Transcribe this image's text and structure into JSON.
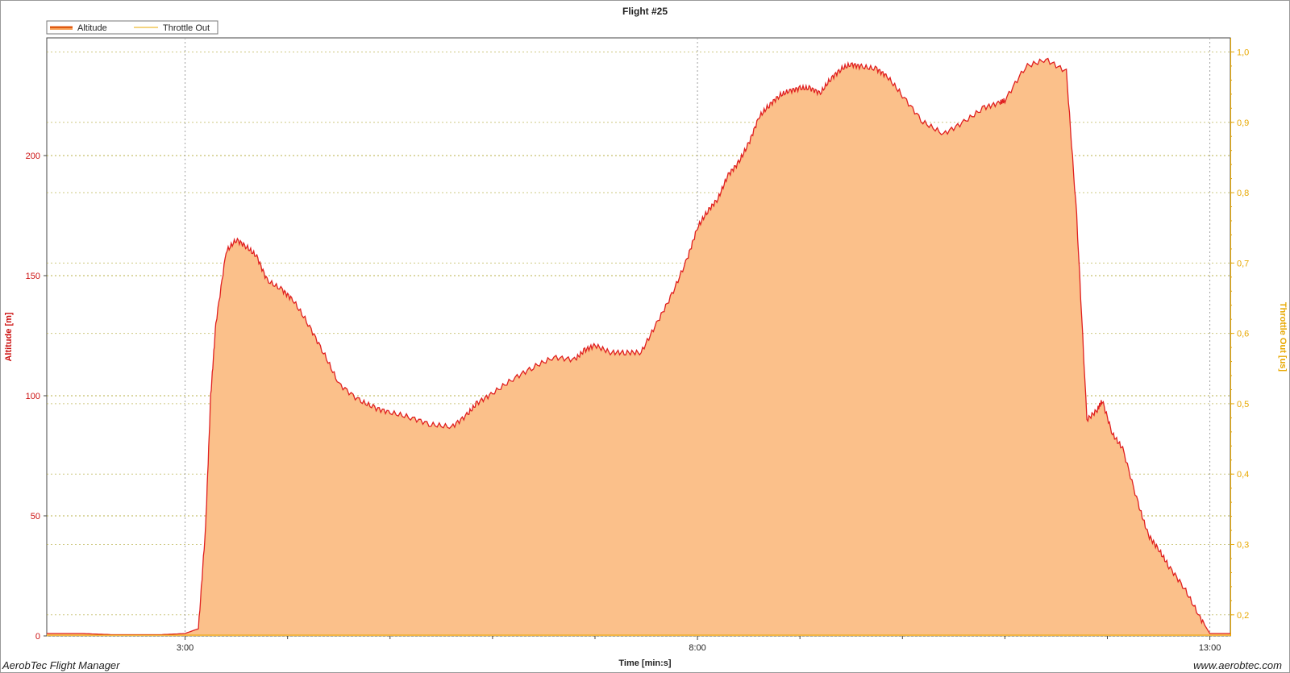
{
  "footer": {
    "app_name": "AerobTec Flight Manager",
    "site_url": "www.aerobtec.com"
  },
  "colors": {
    "altitude": "#e02020",
    "altitude_fill": "#fbc08a",
    "throttle": "#e8a800",
    "grid_y": "#b9b04a",
    "grid_x": "#a0a0a0"
  },
  "chart_data": {
    "type": "area",
    "title": "Flight #25",
    "xlabel": "Time [min:s]",
    "ylabel": "Altitude [m]",
    "y2label": "Throttle Out [us]",
    "legend_position": "top-left",
    "grid": true,
    "xlim_min": [
      1.65,
      13.2
    ],
    "ylim": [
      0,
      249
    ],
    "y2lim": [
      0.17,
      1.02
    ],
    "x_ticks": [
      {
        "label": "3:00",
        "value": 3
      },
      {
        "label": "8:00",
        "value": 8
      },
      {
        "label": "13:00",
        "value": 13
      }
    ],
    "x_minor_ticks": [
      4,
      5,
      6,
      7,
      9,
      10,
      11,
      12
    ],
    "y_ticks": [
      0,
      50,
      100,
      150,
      200
    ],
    "y2_ticks": [
      "0,2",
      "0,3",
      "0,4",
      "0,5",
      "0,6",
      "0,7",
      "0,8",
      "0,9",
      "1,0"
    ],
    "y2_tick_values": [
      0.2,
      0.3,
      0.4,
      0.5,
      0.6,
      0.7,
      0.8,
      0.9,
      1.0
    ],
    "series": [
      {
        "name": "Altitude",
        "x_min": [
          1.65,
          2.0,
          2.3,
          2.5,
          2.75,
          3.0,
          3.13,
          3.2,
          3.25,
          3.3,
          3.4,
          3.5,
          3.6,
          3.7,
          3.8,
          3.95,
          4.05,
          4.2,
          4.35,
          4.5,
          4.7,
          4.85,
          5.0,
          5.2,
          5.4,
          5.6,
          5.75,
          5.85,
          6.0,
          6.2,
          6.4,
          6.6,
          6.8,
          6.9,
          7.0,
          7.15,
          7.3,
          7.45,
          7.6,
          7.75,
          7.9,
          8.0,
          8.1,
          8.2,
          8.3,
          8.4,
          8.5,
          8.6,
          8.7,
          8.8,
          8.9,
          9.0,
          9.1,
          9.2,
          9.3,
          9.4,
          9.5,
          9.6,
          9.75,
          9.85,
          10.0,
          10.2,
          10.4,
          10.6,
          10.8,
          10.95,
          11.0,
          11.2,
          11.4,
          11.6,
          11.7,
          11.8,
          11.9,
          11.95,
          12.05,
          12.15,
          12.3,
          12.4,
          12.5,
          12.6,
          12.75,
          12.9,
          13.0,
          13.2
        ],
        "values": [
          1,
          1,
          0.5,
          0.5,
          0.5,
          1,
          3,
          45,
          100,
          130,
          160,
          165,
          162,
          158,
          148,
          144,
          140,
          130,
          118,
          105,
          98,
          95,
          93,
          91,
          88,
          87,
          92,
          97,
          101,
          107,
          112,
          116,
          115,
          119,
          121,
          118,
          118,
          118,
          130,
          142,
          157,
          170,
          177,
          182,
          192,
          197,
          205,
          216,
          221,
          225,
          227,
          228,
          228,
          226,
          232,
          236,
          238,
          237,
          236,
          233,
          225,
          214,
          209,
          214,
          220,
          222,
          223,
          237,
          240,
          235,
          175,
          90,
          94,
          98,
          84,
          78,
          55,
          42,
          36,
          29,
          20,
          8,
          1,
          1
        ]
      },
      {
        "name": "Throttle Out",
        "x_min": [
          1.65,
          13.2
        ],
        "values": [
          0.17,
          0.17
        ]
      }
    ]
  }
}
